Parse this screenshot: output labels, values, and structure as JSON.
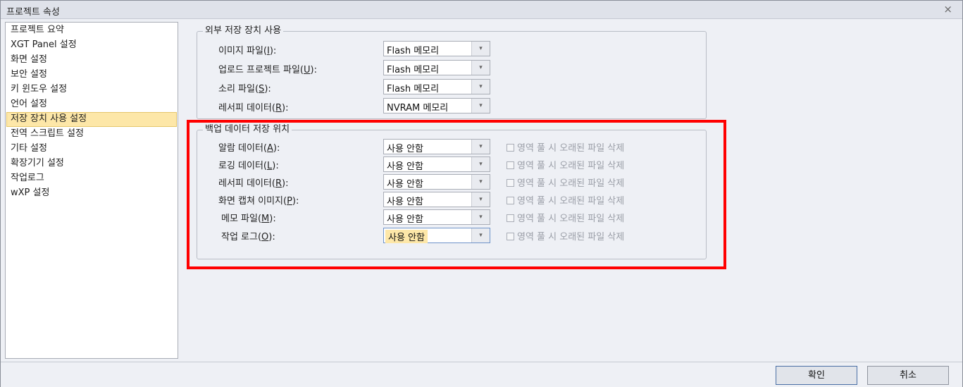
{
  "window": {
    "title": "프로젝트 속성",
    "close_icon": "×"
  },
  "sidebar": {
    "items": [
      {
        "label": "프로젝트 요약"
      },
      {
        "label": "XGT Panel 설정"
      },
      {
        "label": "화면 설정"
      },
      {
        "label": "보안 설정"
      },
      {
        "label": "키 윈도우 설정"
      },
      {
        "label": "언어 설정"
      },
      {
        "label": "저장 장치 사용 설정",
        "selected": true
      },
      {
        "label": "전역 스크립트 설정"
      },
      {
        "label": "기타 설정"
      },
      {
        "label": "확장기기 설정"
      },
      {
        "label": "작업로그"
      },
      {
        "label": "wXP 설정"
      }
    ]
  },
  "external_storage": {
    "legend": "외부 저장 장치 사용",
    "rows": [
      {
        "label": "이미지 파일(",
        "key": "I",
        "label_end": "):",
        "value": "Flash 메모리"
      },
      {
        "label": "업로드 프로젝트 파일(",
        "key": "U",
        "label_end": "):",
        "value": "Flash 메모리"
      },
      {
        "label": "소리 파일(",
        "key": "S",
        "label_end": "):",
        "value": "Flash 메모리"
      },
      {
        "label": "레서피 데이터(",
        "key": "R",
        "label_end": "):",
        "value": "NVRAM 메모리"
      }
    ]
  },
  "backup_storage": {
    "legend": "백업 데이터 저장 위치",
    "checkbox_label": "영역 풀 시 오래된 파일 삭제",
    "rows": [
      {
        "label": "알람 데이터(",
        "key": "A",
        "label_end": "):",
        "value": "사용 안함"
      },
      {
        "label": "로깅 데이터(",
        "key": "L",
        "label_end": "):",
        "value": "사용 안함"
      },
      {
        "label": "레서피 데이터(",
        "key": "R",
        "label_end": "):",
        "value": "사용 안함"
      },
      {
        "label": "화면 캡쳐 이미지(",
        "key": "P",
        "label_end": "):",
        "value": "사용 안함"
      },
      {
        "label": "메모 파일(",
        "key": "M",
        "label_end": "):",
        "value": "사용 안함"
      },
      {
        "label": "작업 로그(",
        "key": "O",
        "label_end": "):",
        "value": "사용 안함",
        "active": true
      }
    ]
  },
  "footer": {
    "ok_label": "확인",
    "cancel_label": "취소"
  },
  "colors": {
    "highlight": "#ff0000",
    "selected": "#fde7a8"
  }
}
